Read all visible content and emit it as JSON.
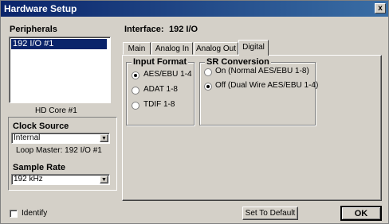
{
  "window": {
    "title": "Hardware Setup",
    "close_glyph": "x"
  },
  "peripherals": {
    "label": "Peripherals",
    "items": [
      "192 I/O #1"
    ],
    "core_label": "HD Core #1"
  },
  "clock": {
    "label": "Clock Source",
    "value": "Internal",
    "loop_master": "Loop Master: 192 I/O #1"
  },
  "sample_rate": {
    "label": "Sample Rate",
    "value": "192 kHz"
  },
  "interface": {
    "label": "Interface:",
    "value": "192 I/O"
  },
  "tabs": [
    {
      "label": "Main",
      "active": false
    },
    {
      "label": "Analog In",
      "active": false
    },
    {
      "label": "Analog Out",
      "active": false
    },
    {
      "label": "Digital",
      "active": true
    }
  ],
  "input_format": {
    "title": "Input Format",
    "options": [
      {
        "label": "AES/EBU 1-4",
        "selected": true
      },
      {
        "label": "ADAT 1-8",
        "selected": false
      },
      {
        "label": "TDIF 1-8",
        "selected": false
      }
    ]
  },
  "sr_conversion": {
    "title": "SR Conversion",
    "options": [
      {
        "label": "On (Normal AES/EBU 1-8)",
        "selected": false
      },
      {
        "label": "Off (Dual Wire AES/EBU 1-4)",
        "selected": true
      }
    ]
  },
  "footer": {
    "identify_label": "Identify",
    "identify_checked": false,
    "default_label": "Set To Default",
    "ok_label": "OK"
  },
  "icons": {
    "dropdown": "chevron-down-icon",
    "close": "close-icon"
  },
  "colors": {
    "titlebar_start": "#0a246a",
    "titlebar_end": "#3a6ea5",
    "face": "#d4d0c8",
    "selection": "#0a246a"
  }
}
